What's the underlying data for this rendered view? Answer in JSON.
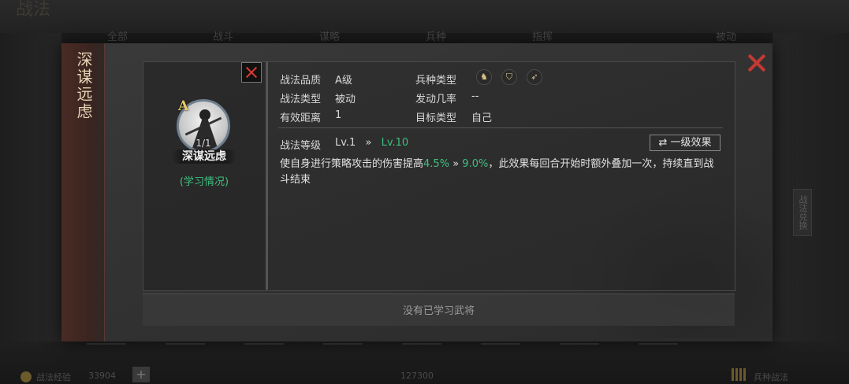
{
  "background": {
    "title": "战法",
    "tabs": [
      "全部",
      "战斗",
      "谋略",
      "兵种",
      "指挥",
      "被动"
    ],
    "side_badge": "战法兑换",
    "bottom_left_label": "战法经验",
    "bottom_left_value": "33904",
    "bottom_center_value": "127300",
    "bottom_right_label": "兵种战法"
  },
  "modal": {
    "side_title": "深谋远虑",
    "close_icon": "close-x-icon",
    "skill": {
      "grade": "A",
      "uses": "1/1",
      "name": "深谋远虑",
      "learn_link": "(学习情况)"
    },
    "attributes": {
      "quality_label": "战法品质",
      "quality_value": "A级",
      "type_label": "战法类型",
      "type_value": "被动",
      "range_label": "有效距离",
      "range_value": "1",
      "troop_label": "兵种类型",
      "troop_icons": [
        "cavalry-icon",
        "shield-icon",
        "bow-icon"
      ],
      "rate_label": "发动几率",
      "rate_value": "--",
      "target_label": "目标类型",
      "target_value": "自己"
    },
    "level": {
      "label": "战法等级",
      "from": "Lv.1",
      "arrow": "»",
      "to": "Lv.10",
      "effect_button": "一级效果"
    },
    "description": {
      "part1": "使自身进行策略攻击的伤害提高",
      "value_from": "4.5%",
      "arrow": "»",
      "value_to": "9.0%",
      "part2": "，此效果每回合开始时额外叠加一次，持续直到战斗结束"
    },
    "bottom_text": "没有已学习武将"
  },
  "colors": {
    "accent_green": "#3fbf7f",
    "close_red": "#c43a33",
    "grade_gold": "#e8c96a"
  }
}
